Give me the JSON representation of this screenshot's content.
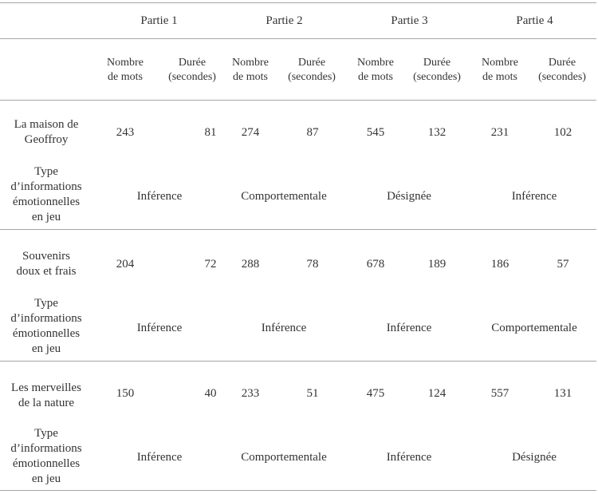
{
  "table": {
    "parts": [
      "Partie 1",
      "Partie 2",
      "Partie 3",
      "Partie 4"
    ],
    "subheaders": {
      "words": [
        "Nombre",
        "de mots"
      ],
      "duration": [
        "Durée",
        "(secondes)"
      ]
    },
    "info_type_label": [
      "Type",
      "d’informations",
      "émotionnelles",
      "en jeu"
    ],
    "stories": [
      {
        "title": [
          "La maison de",
          "Geoffroy"
        ],
        "words": [
          "243",
          "274",
          "545",
          "231"
        ],
        "durations": [
          "81",
          "87",
          "132",
          "102"
        ],
        "info_types": [
          "Inférence",
          "Comportementale",
          "Désignée",
          "Inférence"
        ]
      },
      {
        "title": [
          "Souvenirs",
          "doux et frais"
        ],
        "words": [
          "204",
          "288",
          "678",
          "186"
        ],
        "durations": [
          "72",
          "78",
          "189",
          "57"
        ],
        "info_types": [
          "Inférence",
          "Inférence",
          "Inférence",
          "Comportementale"
        ]
      },
      {
        "title": [
          "Les merveilles",
          "de la nature"
        ],
        "words": [
          "150",
          "233",
          "475",
          "557"
        ],
        "durations": [
          "40",
          "51",
          "124",
          "131"
        ],
        "info_types": [
          "Inférence",
          "Comportementale",
          "Inférence",
          "Désignée"
        ]
      }
    ]
  }
}
